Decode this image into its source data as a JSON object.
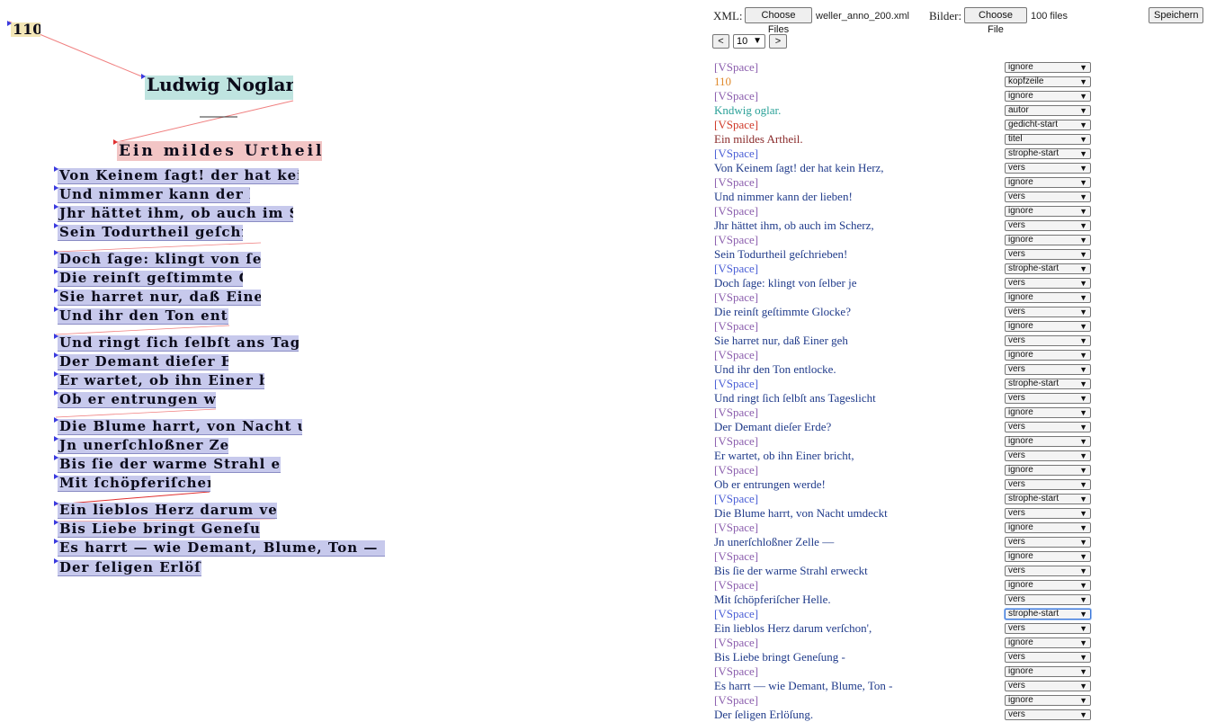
{
  "toolbar": {
    "xml_label": "XML:",
    "xml_button": "Choose Files",
    "xml_file": "weller_anno_200.xml",
    "images_label": "Bilder:",
    "images_button": "Choose File",
    "images_count": "100 files",
    "save_button": "Speichern"
  },
  "pager": {
    "prev": "<",
    "page": "10",
    "next": ">"
  },
  "colors": {
    "ignore": "#8c5fae",
    "kopfzeile": "#e08a2c",
    "autor": "#2aa198",
    "gedicht-start": "#d03a2a",
    "titel": "#8a2b2b",
    "strophe-start": "#4b5fd6",
    "vers": "#1f3a8a"
  },
  "facsimile": [
    {
      "text": "110",
      "kind": "kopf"
    },
    {
      "text": "Ludwig Noglar.",
      "kind": "autor"
    },
    {
      "text": "Ein mildes Urtheil.",
      "kind": "titel"
    },
    {
      "text": "Von Keinem ſagt! der hat kein Herz,",
      "kind": "vers"
    },
    {
      "text": "Und nimmer kann der lieben!",
      "kind": "vers"
    },
    {
      "text": "Jhr hättet ihm, ob auch im Scherz,",
      "kind": "vers"
    },
    {
      "text": "Sein Todurtheil geſchrieben!",
      "kind": "vers"
    },
    {
      "text": "Doch ſage: klingt von ſelber je",
      "kind": "vers"
    },
    {
      "text": "Die reinſt geſtimmte Glocke?",
      "kind": "vers"
    },
    {
      "text": "Sie harret nur, daß Einer geh",
      "kind": "vers"
    },
    {
      "text": "Und ihr den Ton entlocke.",
      "kind": "vers"
    },
    {
      "text": "Und ringt ſich ſelbſt ans Tageslicht",
      "kind": "vers"
    },
    {
      "text": "Der Demant dieſer Erde?",
      "kind": "vers"
    },
    {
      "text": "Er wartet, ob ihn Einer bricht,",
      "kind": "vers"
    },
    {
      "text": "Ob er entrungen werde!",
      "kind": "vers"
    },
    {
      "text": "Die Blume harrt, von Nacht umdeckt",
      "kind": "vers"
    },
    {
      "text": "Jn unerſchloßner Zelle —",
      "kind": "vers"
    },
    {
      "text": "Bis ſie der warme Strahl erweckt",
      "kind": "vers"
    },
    {
      "text": "Mit ſchöpferiſcher Helle.",
      "kind": "vers"
    },
    {
      "text": "Ein lieblos Herz darum verſchon',",
      "kind": "vers"
    },
    {
      "text": "Bis Liebe bringt Geneſung —",
      "kind": "vers"
    },
    {
      "text": "Es harrt — wie Demant, Blume, Ton —",
      "kind": "vers"
    },
    {
      "text": "Der ſeligen Erlöſung.",
      "kind": "vers"
    }
  ],
  "rows": [
    {
      "text": "[VSpace]",
      "label": "ignore",
      "color": "ignore"
    },
    {
      "text": "110",
      "label": "kopfzeile",
      "color": "kopfzeile"
    },
    {
      "text": "[VSpace]",
      "label": "ignore",
      "color": "ignore"
    },
    {
      "text": "Kndwig oglar.",
      "label": "autor",
      "color": "autor"
    },
    {
      "text": "[VSpace]",
      "label": "gedicht-start",
      "color": "gedicht-start"
    },
    {
      "text": "Ein mildes Artheil.",
      "label": "titel",
      "color": "titel"
    },
    {
      "text": "[VSpace]",
      "label": "strophe-start",
      "color": "strophe-start"
    },
    {
      "text": "Von Keinem ſagt! der hat kein Herz,",
      "label": "vers",
      "color": "vers"
    },
    {
      "text": "[VSpace]",
      "label": "ignore",
      "color": "ignore"
    },
    {
      "text": "Und nimmer kann der lieben!",
      "label": "vers",
      "color": "vers"
    },
    {
      "text": "[VSpace]",
      "label": "ignore",
      "color": "ignore"
    },
    {
      "text": "Jhr hättet ihm, ob auch im Scherz,",
      "label": "vers",
      "color": "vers"
    },
    {
      "text": "[VSpace]",
      "label": "ignore",
      "color": "ignore"
    },
    {
      "text": "Sein Todurtheil geſchrieben!",
      "label": "vers",
      "color": "vers"
    },
    {
      "text": "[VSpace]",
      "label": "strophe-start",
      "color": "strophe-start"
    },
    {
      "text": "Doch ſage: klingt von ſelber je",
      "label": "vers",
      "color": "vers"
    },
    {
      "text": "[VSpace]",
      "label": "ignore",
      "color": "ignore"
    },
    {
      "text": "Die reinſt geſtimmte Glocke?",
      "label": "vers",
      "color": "vers"
    },
    {
      "text": "[VSpace]",
      "label": "ignore",
      "color": "ignore"
    },
    {
      "text": "Sie harret nur, daß Einer geh",
      "label": "vers",
      "color": "vers"
    },
    {
      "text": "[VSpace]",
      "label": "ignore",
      "color": "ignore"
    },
    {
      "text": "Und ihr den Ton entlocke.",
      "label": "vers",
      "color": "vers"
    },
    {
      "text": "[VSpace]",
      "label": "strophe-start",
      "color": "strophe-start"
    },
    {
      "text": "Und ringt ſich ſelbſt ans Tageslicht",
      "label": "vers",
      "color": "vers"
    },
    {
      "text": "[VSpace]",
      "label": "ignore",
      "color": "ignore"
    },
    {
      "text": "Der Demant dieſer Erde?",
      "label": "vers",
      "color": "vers"
    },
    {
      "text": "[VSpace]",
      "label": "ignore",
      "color": "ignore"
    },
    {
      "text": "Er wartet, ob ihn Einer bricht,",
      "label": "vers",
      "color": "vers"
    },
    {
      "text": "[VSpace]",
      "label": "ignore",
      "color": "ignore"
    },
    {
      "text": "Ob er entrungen werde!",
      "label": "vers",
      "color": "vers"
    },
    {
      "text": "[VSpace]",
      "label": "strophe-start",
      "color": "strophe-start"
    },
    {
      "text": "Die Blume harrt, von Nacht umdeckt",
      "label": "vers",
      "color": "vers"
    },
    {
      "text": "[VSpace]",
      "label": "ignore",
      "color": "ignore"
    },
    {
      "text": "Jn unerſchloßner Zelle —",
      "label": "vers",
      "color": "vers"
    },
    {
      "text": "[VSpace]",
      "label": "ignore",
      "color": "ignore"
    },
    {
      "text": "Bis ſie der warme Strahl erweckt",
      "label": "vers",
      "color": "vers"
    },
    {
      "text": "[VSpace]",
      "label": "ignore",
      "color": "ignore"
    },
    {
      "text": "Mit ſchöpferiſcher Helle.",
      "label": "vers",
      "color": "vers"
    },
    {
      "text": "[VSpace]",
      "label": "strophe-start",
      "color": "strophe-start",
      "focused": true
    },
    {
      "text": "Ein lieblos Herz darum verſchon',",
      "label": "vers",
      "color": "vers"
    },
    {
      "text": "[VSpace]",
      "label": "ignore",
      "color": "ignore"
    },
    {
      "text": "Bis Liebe bringt Geneſung -",
      "label": "vers",
      "color": "vers"
    },
    {
      "text": "[VSpace]",
      "label": "ignore",
      "color": "ignore"
    },
    {
      "text": "Es harrt — wie Demant, Blume, Ton -",
      "label": "vers",
      "color": "vers"
    },
    {
      "text": "[VSpace]",
      "label": "ignore",
      "color": "ignore"
    },
    {
      "text": "Der ſeligen Erlöſung.",
      "label": "vers",
      "color": "vers"
    }
  ]
}
